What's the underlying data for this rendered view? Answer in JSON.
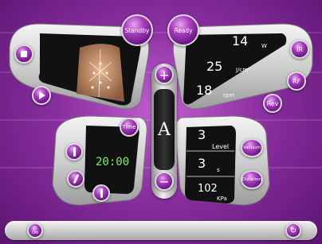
{
  "top_buttons": {
    "standby": "Standby",
    "ready": "Ready"
  },
  "power": {
    "w_value": "14",
    "w_unit": "W",
    "j_value": "25",
    "j_unit": "J/cm²",
    "rpm_value": "18",
    "rpm_unit": "rpm"
  },
  "side_buttons": {
    "ir": "IR",
    "rf": "RF",
    "rev": "Rev"
  },
  "center": {
    "mode": "A"
  },
  "timer": {
    "label": "Time",
    "value": "20:00"
  },
  "vacuum": {
    "level_value": "3",
    "level_unit": "Level",
    "s_value": "3",
    "s_unit": "s",
    "kpa_value": "102",
    "kpa_unit": "KPa",
    "vacuum_btn": "Vacuum",
    "duration_btn": "Duration"
  },
  "bottom": {
    "power_btn": "ON"
  },
  "colors": {
    "accent": "#a93fc0",
    "timer_digits": "#7cf25a",
    "panel_silver": "#d6d6d6"
  }
}
